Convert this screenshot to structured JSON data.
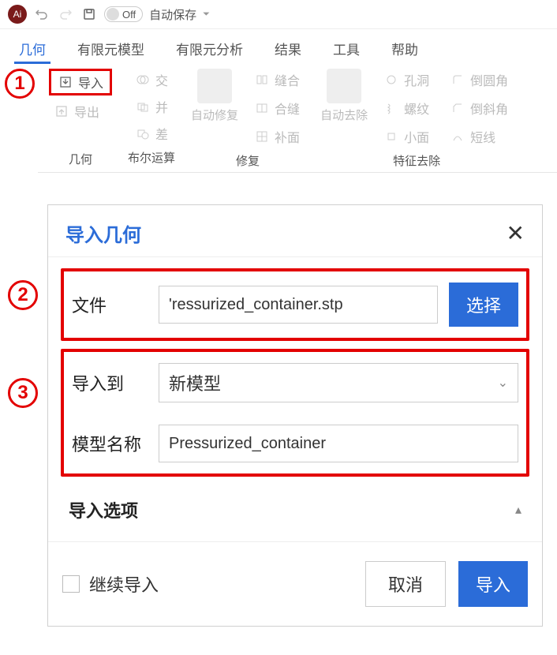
{
  "topbar": {
    "app_icon_text": "Ai",
    "toggle_label": "Off",
    "autosave": "自动保存"
  },
  "tabs": {
    "items": [
      "几何",
      "有限元模型",
      "有限元分析",
      "结果",
      "工具",
      "帮助"
    ],
    "active_index": 0
  },
  "ribbon": {
    "groups": {
      "geometry": {
        "title": "几何",
        "import": "导入",
        "export": "导出"
      },
      "boolean": {
        "title": "布尔运算",
        "intersect": "交",
        "union": "并",
        "subtract": "差"
      },
      "repair": {
        "title": "修复",
        "auto_repair": "自动修复",
        "sew": "缝合",
        "stitch": "合缝",
        "fill": "补面"
      },
      "feature_remove": {
        "title": "特征去除",
        "auto_remove": "自动去除",
        "hole": "孔洞",
        "thread": "螺纹",
        "small_face": "小面",
        "fillet": "倒圆角",
        "chamfer": "倒斜角",
        "short_edge": "短线"
      }
    }
  },
  "dialog": {
    "title": "导入几何",
    "file_label": "文件",
    "file_value": "'ressurized_container.stp",
    "select_btn": "选择",
    "import_to_label": "导入到",
    "import_to_value": "新模型",
    "model_name_label": "模型名称",
    "model_name_value": "Pressurized_container",
    "options_title": "导入选项",
    "continue_import": "继续导入",
    "cancel": "取消",
    "import": "导入"
  },
  "annotations": {
    "one": "1",
    "two": "2",
    "three": "3"
  }
}
